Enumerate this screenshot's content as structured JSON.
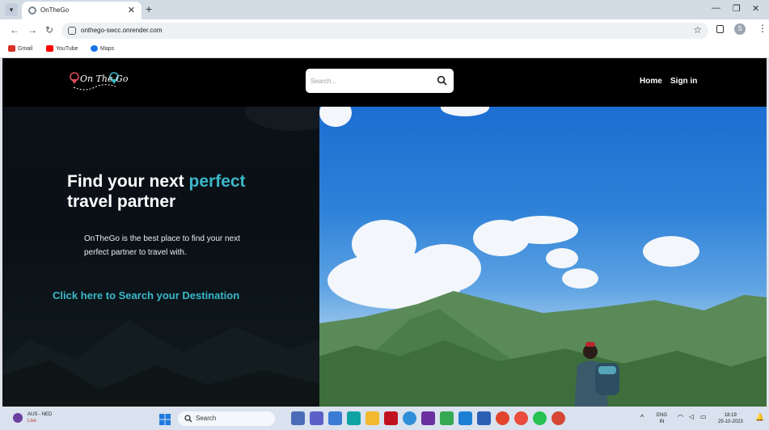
{
  "browser": {
    "tab_title": "OnTheGo",
    "url": "onthego-swcc.onrender.com",
    "bookmarks": [
      {
        "label": "Gmail",
        "icon": "gmail-icon",
        "color": "#d93025"
      },
      {
        "label": "YouTube",
        "icon": "youtube-icon",
        "color": "#ff0000"
      },
      {
        "label": "Maps",
        "icon": "maps-icon",
        "color": "#1a73e8"
      }
    ],
    "profile_initial": "S"
  },
  "site": {
    "logo_text": "On The Go",
    "search_placeholder": "Search...",
    "nav": {
      "home": "Home",
      "signin": "Sign in"
    }
  },
  "hero": {
    "headline_part1": "Find your next ",
    "headline_accent": "perfect",
    "headline_part2": "travel partner",
    "description": "OnTheGo is the best place to find your next perfect partner to travel with.",
    "cta": "Click here to Search your Destination",
    "accent_color": "#3ab8c9"
  },
  "taskbar": {
    "weather_line1": "AUS - NED",
    "weather_line2": "Live",
    "search_label": "Search",
    "lang_line1": "ENG",
    "lang_line2": "IN",
    "time": "18:19",
    "date": "25-10-2023"
  }
}
